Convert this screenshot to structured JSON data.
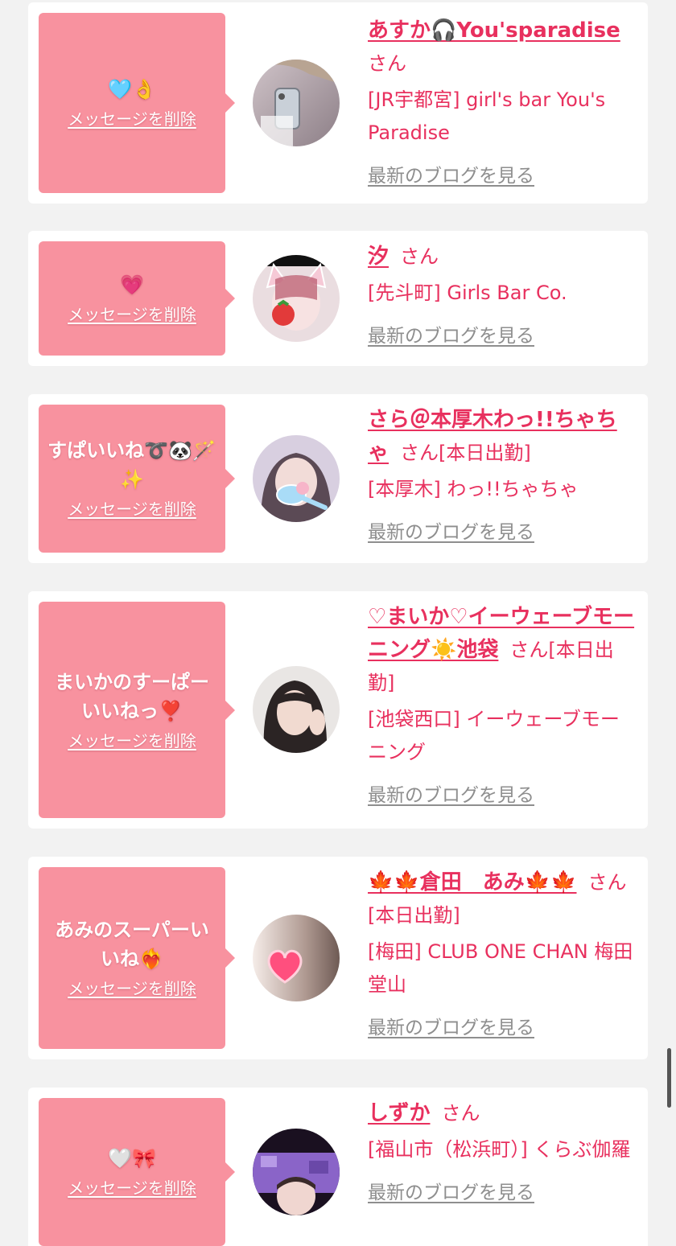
{
  "theme": {
    "accent": "#e8305e",
    "bubble": "#f8929f",
    "link_gray": "#8e8e8e",
    "background": "#f2f2f2"
  },
  "delete_label": "メッセージを削除",
  "blog_label": "最新のブログを見る",
  "honorific": "さん",
  "items": [
    {
      "message": "🩵👌",
      "name": "あすか🎧You'sparadise",
      "status": "",
      "shop": "[JR宇都宮] girl's bar You's Paradise",
      "avatar_icon": "avatar-photo-icon"
    },
    {
      "message": "💗",
      "name": "汐",
      "status": "",
      "shop": "[先斗町] Girls Bar Co.",
      "avatar_icon": "avatar-photo-icon"
    },
    {
      "message": "すぱいいね➰🐼🪄✨",
      "name": "さら＠本厚木わっ!!ちゃちゃ",
      "status": "[本日出勤]",
      "shop": "[本厚木] わっ!!ちゃちゃ",
      "avatar_icon": "avatar-photo-icon"
    },
    {
      "message": "まいかのすーぱーいいねっ❣️",
      "name": "♡まいか♡イーウェーブモーニング☀️池袋",
      "status": "[本日出勤]",
      "shop": "[池袋西口] イーウェーブモーニング",
      "avatar_icon": "avatar-photo-icon"
    },
    {
      "message": "あみのスーパーいいね❤️‍🔥",
      "name": "🍁🍁倉田　あみ🍁🍁",
      "status": "[本日出勤]",
      "shop": "[梅田] CLUB ONE CHAN 梅田堂山",
      "avatar_icon": "avatar-photo-icon"
    },
    {
      "message": "🤍🎀",
      "name": "しずか",
      "status": "",
      "shop": "[福山市（松浜町）] くらぶ伽羅",
      "avatar_icon": "avatar-photo-icon"
    }
  ]
}
